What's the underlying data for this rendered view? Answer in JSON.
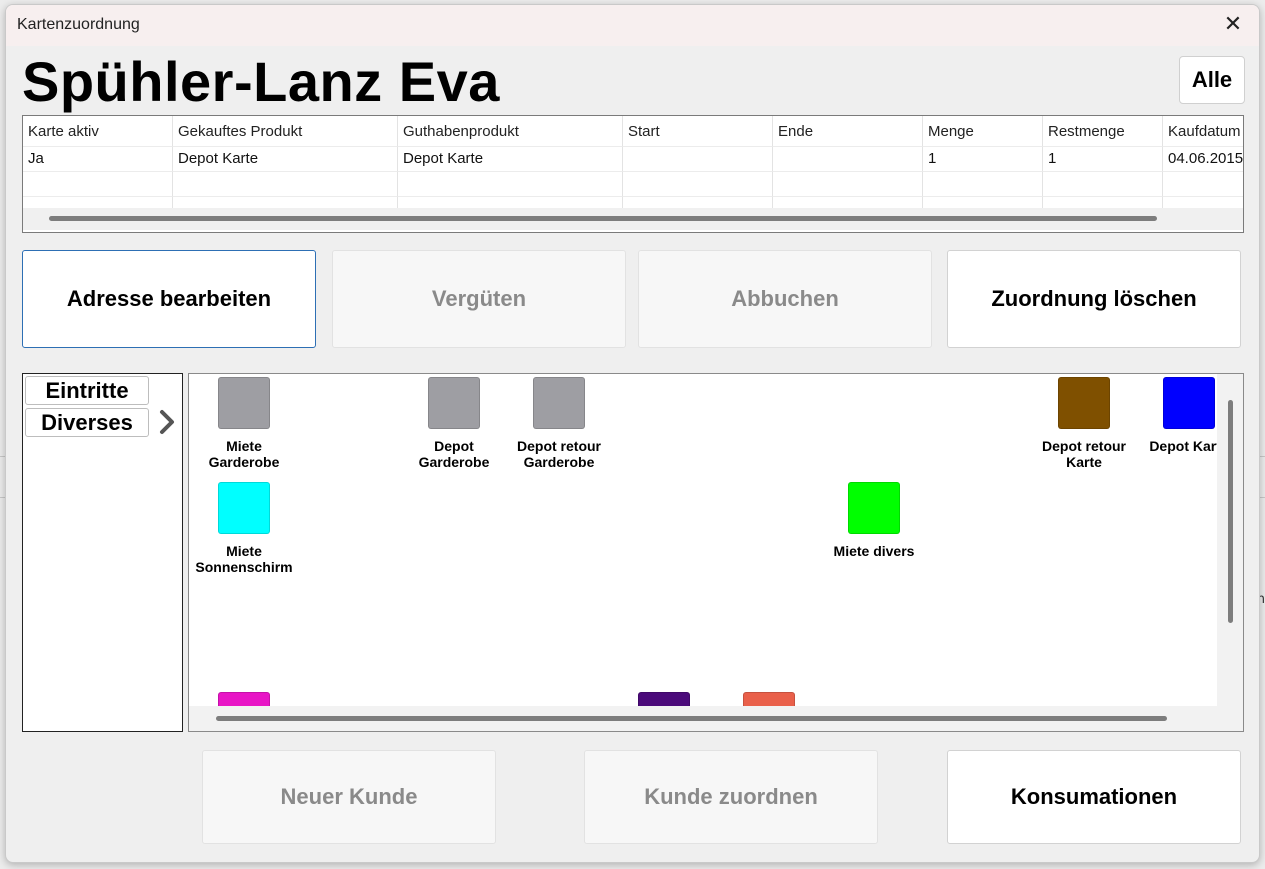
{
  "window": {
    "title": "Kartenzuordnung",
    "close_glyph": "✕"
  },
  "customer": {
    "name": "Spühler-Lanz Eva"
  },
  "alle_button": {
    "label": "Alle"
  },
  "table": {
    "columns": [
      "Karte aktiv",
      "Gekauftes Produkt",
      "Guthabenprodukt",
      "Start",
      "Ende",
      "Menge",
      "Restmenge",
      "Kaufdatum"
    ],
    "rows": [
      [
        "Ja",
        "Depot Karte",
        "Depot Karte",
        "",
        "",
        "1",
        "1",
        "04.06.2015"
      ],
      [
        "",
        "",
        "",
        "",
        "",
        "",
        "",
        ""
      ],
      [
        "",
        "",
        "",
        "",
        "",
        "",
        "",
        ""
      ]
    ]
  },
  "actions": {
    "adresse_bearbeiten": "Adresse bearbeiten",
    "verguten": "Vergüten",
    "abbuchen": "Abbuchen",
    "zuordnung_loschen": "Zuordnung löschen"
  },
  "categories": {
    "eintritte": "Eintritte",
    "diverses": "Diverses"
  },
  "products": [
    {
      "label": "Miete\nGarderobe",
      "color": "#9e9ea3"
    },
    {
      "label": "Depot\nGarderobe",
      "color": "#9e9ea3"
    },
    {
      "label": "Depot retour\nGarderobe",
      "color": "#9e9ea3"
    },
    {
      "label": "Depot retour\nKarte",
      "color": "#7f5000"
    },
    {
      "label": "Depot Karte",
      "color": "#0000ff"
    },
    {
      "label": "Miete\nSonnenschirm",
      "color": "#00ffff"
    },
    {
      "label": "Miete divers",
      "color": "#00ff00"
    },
    {
      "label": "",
      "color": "#e815c6"
    },
    {
      "label": "",
      "color": "#4b0a7a"
    },
    {
      "label": "",
      "color": "#e9604a"
    }
  ],
  "bottom": {
    "neuer_kunde": "Neuer Kunde",
    "kunde_zuordnen": "Kunde zuordnen",
    "konsumationen": "Konsumationen"
  },
  "background": {
    "side_text": "m"
  }
}
